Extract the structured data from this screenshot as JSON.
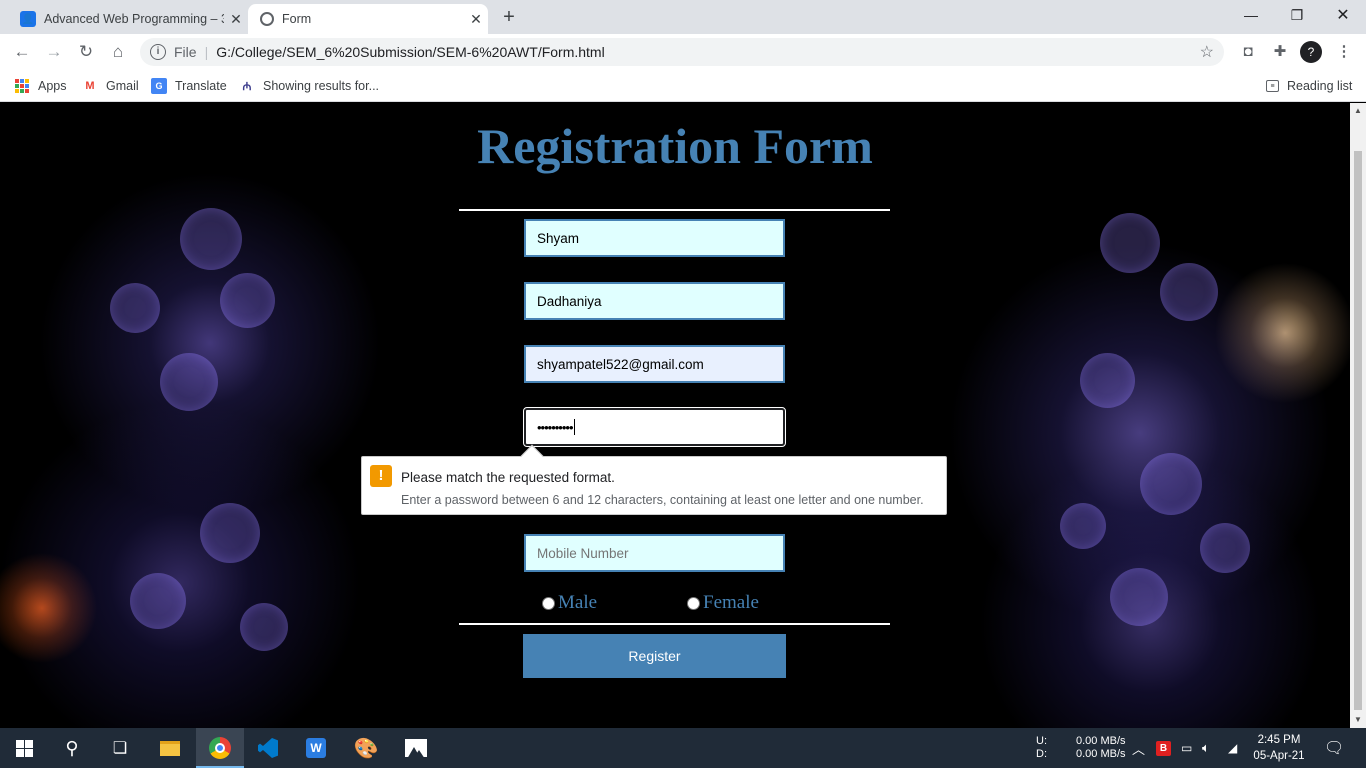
{
  "browser": {
    "tabs": [
      {
        "title": "Advanced Web Programming – 3",
        "active": false
      },
      {
        "title": "Form",
        "active": true
      }
    ],
    "url_scheme": "File",
    "url": "G:/College/SEM_6%20Submission/SEM-6%20AWT/Form.html",
    "bookmarks": [
      "Apps",
      "Gmail",
      "Translate",
      "Showing results for..."
    ],
    "reading_list": "Reading list",
    "profile_initial": "?"
  },
  "page": {
    "title": "Registration Form",
    "fields": {
      "first_name": "Shyam",
      "last_name": "Dadhaniya",
      "email": "shyampatel522@gmail.com",
      "password_masked": "••••••••••",
      "mobile_placeholder": "Mobile Number"
    },
    "validation": {
      "message": "Please match the requested format.",
      "hint": "Enter a password between 6 and 12 characters, containing at least one letter and one number."
    },
    "gender_options": [
      "Male",
      "Female"
    ],
    "register_label": "Register",
    "accent_color": "#4682b4"
  },
  "taskbar": {
    "net_up_label": "U:",
    "net_down_label": "D:",
    "net_up": "0.00 MB/s",
    "net_down": "0.00 MB/s",
    "time": "2:45 PM",
    "date": "05-Apr-21"
  }
}
